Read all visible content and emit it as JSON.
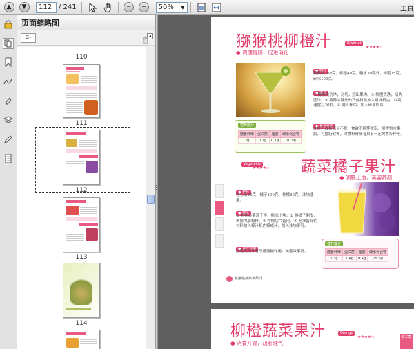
{
  "toolbar": {
    "page_input": "112",
    "page_total": "/ 241",
    "zoom_value": "50%"
  },
  "panel": {
    "title": "页面缩略图"
  },
  "thumbnails": [
    {
      "label": "110"
    },
    {
      "label": "111"
    },
    {
      "label": "112"
    },
    {
      "label": "113"
    },
    {
      "label": "114"
    }
  ],
  "toolbar_right": "工具",
  "page1": {
    "title": "猕猴桃柳橙汁",
    "title_en": "Kiwifruit",
    "subtitle": "● 调理胃肠，促进消化",
    "stars": "★★★★☆",
    "tag_material": "● 材料",
    "material_text": "猕猴桃100克，柳橙40克，糖水30毫升，蜂蜜15克，碎冰100克。",
    "tag_method": "● 做法",
    "method_text": "① 猕猴桃洗净，对切，挖出果肉。② 柳橙洗净，切片压汁。③ 将碎冰除外的其他材料放入搅拌机内，以高速搅打30秒。④ 倒入杯中，加入碎冰即可。",
    "nutrition_tag": "营养成分",
    "nutrition_headers": [
      "膳食纤维",
      "蛋白质",
      "脂肪",
      "碳水化合物"
    ],
    "nutrition_values": [
      "2g",
      "0.7g",
      "0.1g",
      "20.9g"
    ],
    "effect_tag": "● 食疗作用",
    "effect_text": "此饮可改善消化不良、食欲不振等状况。柳橙饱含果胶，可整肠健胃，对食积胃痛者具有一定的食疗作用。"
  },
  "page2": {
    "title": "蔬菜橘子果汁",
    "title_en": "Vegetable",
    "subtitle": "● 润肠止血，美容养颜",
    "stars": "★★★★☆",
    "tag_material": "● 材料",
    "material_text": "卷心菜30克，橘子100克，柠檬30克，冰块适量。",
    "tag_method": "● 做法",
    "method_text": "① 将卷心菜洗干净，撕成小块。② 将橘子剥皮，去掉内膜和籽。③ 柠檬切片备用。④ 把准备好的材料放入榨汁机内榨成汁，加入冰块即可。",
    "effect_tag": "● 食疗作用",
    "effect_text": "此道蔬菜汁有改善便秘作用，美容效果好。",
    "nutrition_tag": "营养成分",
    "nutrition_headers": [
      "膳食纤维",
      "蛋白质",
      "脂肪",
      "碳水化合物"
    ],
    "nutrition_values": [
      "1.3g",
      "1.4g",
      "0.4g",
      "25.6g"
    ],
    "footer_text": "猕猴桃蔬菜水果汁"
  },
  "page3": {
    "title": "柳橙蔬菜果汁",
    "title_en": "Orange",
    "subtitle": "● 消食开胃，疏肝理气",
    "stars": "★★★★☆",
    "side_tab": "第二章"
  }
}
